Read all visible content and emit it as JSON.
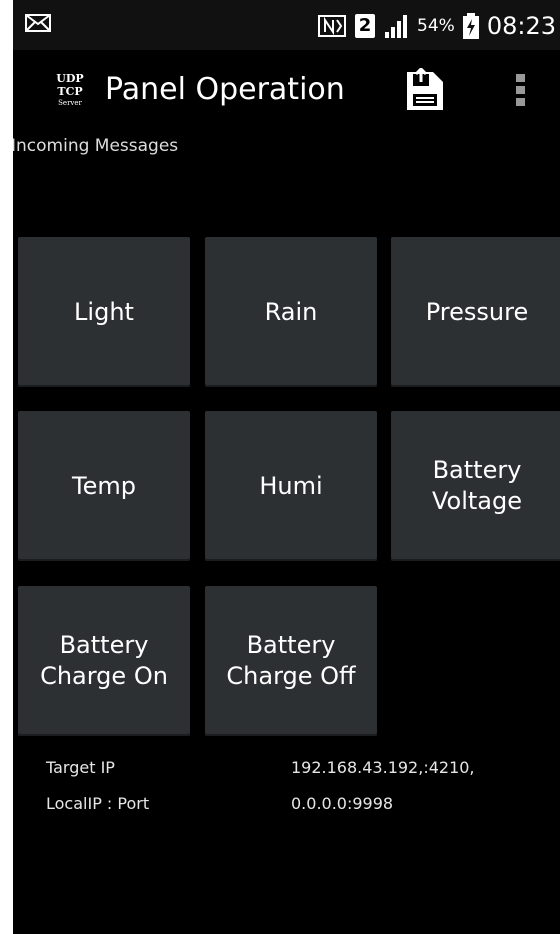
{
  "status_bar": {
    "battery_percent": "54%",
    "time": "08:23",
    "sim_slot": "2",
    "icons": [
      "mail-icon",
      "nfc-icon",
      "signal-icon",
      "battery-charging-icon"
    ]
  },
  "action_bar": {
    "title": "Panel Operation",
    "logo_text": [
      "UDP",
      "TCP",
      "Server"
    ],
    "icons": [
      "save-icon",
      "overflow-menu-icon"
    ]
  },
  "incoming_label": "Incoming Messages",
  "buttons": [
    {
      "label": "Light"
    },
    {
      "label": "Rain"
    },
    {
      "label": "Pressure"
    },
    {
      "label": "Temp"
    },
    {
      "label": "Humi"
    },
    {
      "label": "Battery\nVoltage"
    },
    {
      "label": "Battery\nCharge On"
    },
    {
      "label": "Battery\nCharge Off"
    }
  ],
  "info": {
    "target_ip_label": "Target IP",
    "target_ip_value": "192.168.43.192,:4210,",
    "local_label": "LocalIP : Port",
    "local_value": "0.0.0.0:9998"
  },
  "colors": {
    "background": "#000000",
    "tile": "#2d3033",
    "text": "#ffffff"
  }
}
